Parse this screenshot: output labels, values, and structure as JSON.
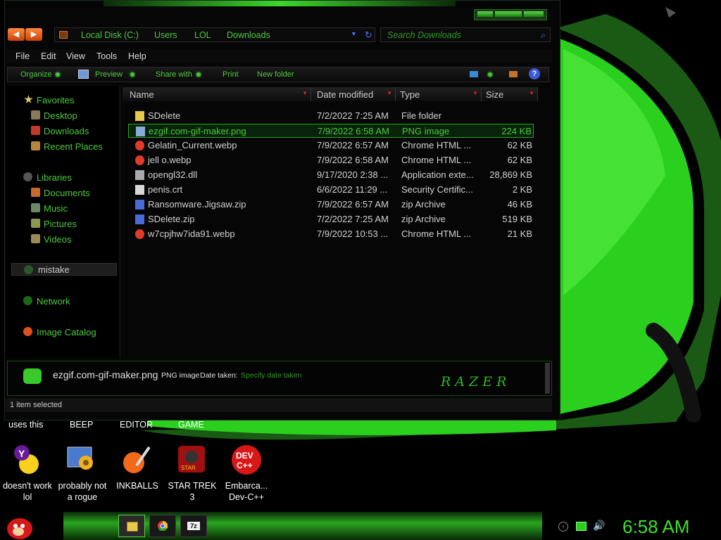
{
  "colors": {
    "accent": "#4ec93e",
    "window_bg": "#060606",
    "selection": "#07230a",
    "header_arrow": "#e02020"
  },
  "window": {
    "address": {
      "crumbs": [
        "Local Disk (C:)",
        "Users",
        "LOL",
        "Downloads"
      ]
    },
    "search": {
      "placeholder": "Search Downloads"
    },
    "menu": [
      "File",
      "Edit",
      "View",
      "Tools",
      "Help"
    ],
    "toolbar": {
      "organize": "Organize",
      "preview": "Preview",
      "share_with": "Share with",
      "print": "Print",
      "new_folder": "New folder",
      "help": "?"
    },
    "nav": {
      "favorites": "Favorites",
      "desktop": "Desktop",
      "downloads": "Downloads",
      "recent_places": "Recent Places",
      "libraries": "Libraries",
      "documents": "Documents",
      "music": "Music",
      "pictures": "Pictures",
      "videos": "Videos",
      "mistake": "mistake",
      "network": "Network",
      "image_catalog": "Image Catalog"
    },
    "columns": {
      "name": "Name",
      "date_modified": "Date modified",
      "type": "Type",
      "size": "Size"
    },
    "files": [
      {
        "name": "SDelete",
        "date": "7/2/2022 7:25 AM",
        "type": "File folder",
        "size": "",
        "icon": "folder-icon"
      },
      {
        "name": "ezgif.com-gif-maker.png",
        "date": "7/9/2022 6:58 AM",
        "type": "PNG image",
        "size": "224 KB",
        "icon": "image-file-icon"
      },
      {
        "name": "Gelatin_Current.webp",
        "date": "7/9/2022 6:57 AM",
        "type": "Chrome HTML ...",
        "size": "62 KB",
        "icon": "chrome-icon"
      },
      {
        "name": "jell o.webp",
        "date": "7/9/2022 6:58 AM",
        "type": "Chrome HTML ...",
        "size": "62 KB",
        "icon": "chrome-icon"
      },
      {
        "name": "opengl32.dll",
        "date": "9/17/2020 2:38 ...",
        "type": "Application exte...",
        "size": "28,869 KB",
        "icon": "dll-icon"
      },
      {
        "name": "penis.crt",
        "date": "6/6/2022 11:29 ...",
        "type": "Security Certific...",
        "size": "2 KB",
        "icon": "certificate-icon"
      },
      {
        "name": "Ransomware.Jigsaw.zip",
        "date": "7/9/2022 6:57 AM",
        "type": "zip Archive",
        "size": "46 KB",
        "icon": "zip-icon"
      },
      {
        "name": "SDelete.zip",
        "date": "7/2/2022 7:25 AM",
        "type": "zip Archive",
        "size": "519 KB",
        "icon": "zip-icon"
      },
      {
        "name": "w7cpjhw7ida91.webp",
        "date": "7/9/2022 10:53 ...",
        "type": "Chrome HTML ...",
        "size": "21 KB",
        "icon": "chrome-icon"
      }
    ],
    "details": {
      "filename": "ezgif.com-gif-maker.png",
      "type": "PNG image",
      "date_taken_label": "Date taken:",
      "date_taken_value": "Specify date taken",
      "logo": "RAZER"
    },
    "status": "1 item selected"
  },
  "desktop": {
    "top_row_labels": [
      "uses this",
      "BEEP",
      "EDITOR",
      "GAME"
    ],
    "icons": [
      {
        "label_l1": "doesn't work",
        "label_l2": "lol",
        "icon": "yahoo-messenger-icon"
      },
      {
        "label_l1": "probably not",
        "label_l2": "a rogue",
        "icon": "settings-gears-icon"
      },
      {
        "label_l1": "INKBALLS",
        "label_l2": "",
        "icon": "inkball-icon"
      },
      {
        "label_l1": "STAR TREK",
        "label_l2": "3",
        "icon": "star-trek-icon"
      },
      {
        "label_l1": "Embarca...",
        "label_l2": "Dev-C++",
        "icon": "dev-cpp-icon"
      }
    ]
  },
  "taskbar": {
    "clock": "6:58 AM",
    "pinned": [
      "explorer-icon",
      "chrome-icon",
      "7zip-icon"
    ]
  }
}
